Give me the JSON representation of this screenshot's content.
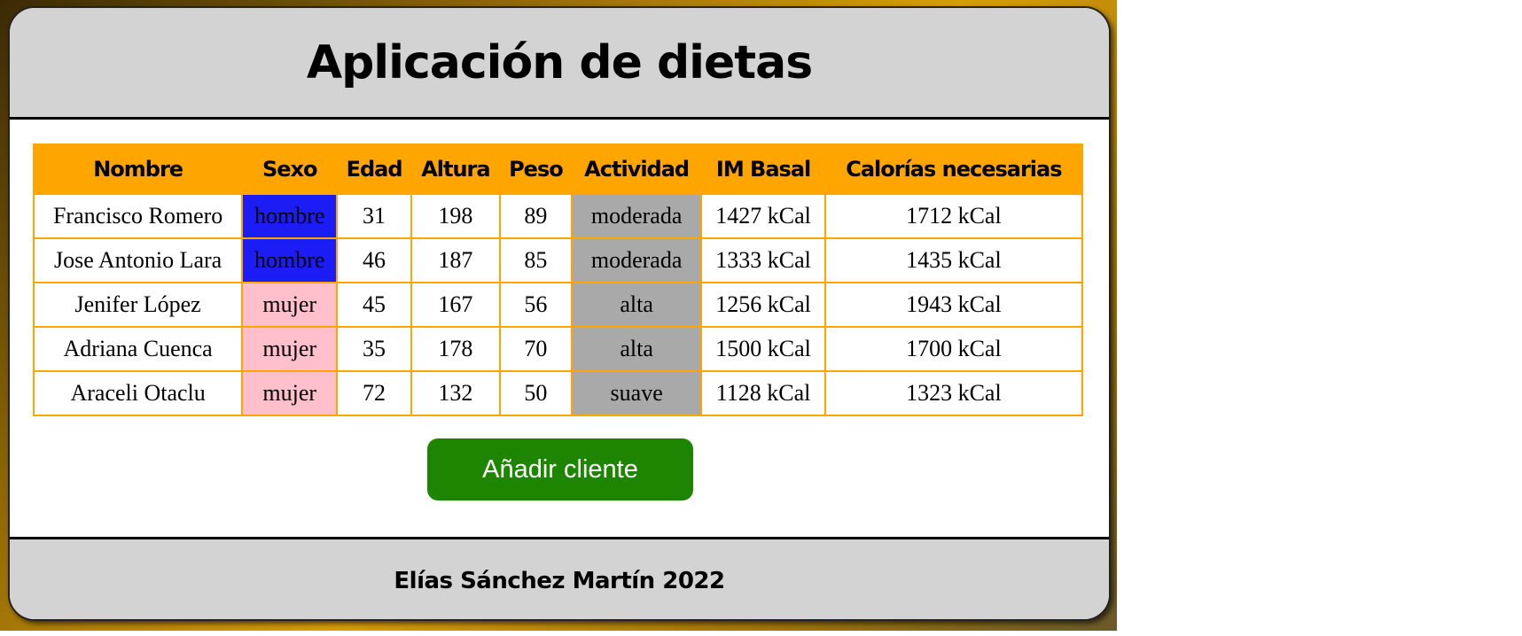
{
  "header": {
    "title": "Aplicación de dietas"
  },
  "table": {
    "columns": [
      "Nombre",
      "Sexo",
      "Edad",
      "Altura",
      "Peso",
      "Actividad",
      "IM Basal",
      "Calorías necesarias"
    ],
    "rows": [
      {
        "nombre": "Francisco Romero",
        "sexo": "hombre",
        "edad": "31",
        "altura": "198",
        "peso": "89",
        "actividad": "moderada",
        "im_basal": "1427 kCal",
        "calorias": "1712 kCal"
      },
      {
        "nombre": "Jose Antonio Lara",
        "sexo": "hombre",
        "edad": "46",
        "altura": "187",
        "peso": "85",
        "actividad": "moderada",
        "im_basal": "1333 kCal",
        "calorias": "1435 kCal"
      },
      {
        "nombre": "Jenifer López",
        "sexo": "mujer",
        "edad": "45",
        "altura": "167",
        "peso": "56",
        "actividad": "alta",
        "im_basal": "1256 kCal",
        "calorias": "1943 kCal"
      },
      {
        "nombre": "Adriana Cuenca",
        "sexo": "mujer",
        "edad": "35",
        "altura": "178",
        "peso": "70",
        "actividad": "alta",
        "im_basal": "1500 kCal",
        "calorias": "1700 kCal"
      },
      {
        "nombre": "Araceli Otaclu",
        "sexo": "mujer",
        "edad": "72",
        "altura": "132",
        "peso": "50",
        "actividad": "suave",
        "im_basal": "1128 kCal",
        "calorias": "1323 kCal"
      }
    ]
  },
  "actions": {
    "add_client_label": "Añadir cliente"
  },
  "footer": {
    "text": "Elías Sánchez Martín 2022"
  },
  "colors": {
    "header_bg": "#d3d3d3",
    "table_header_bg": "#ffa500",
    "hombre_bg": "#1c1cf5",
    "mujer_bg": "#ffc0cb",
    "actividad_bg": "#a9a9a9",
    "button_bg": "#1e8500"
  }
}
